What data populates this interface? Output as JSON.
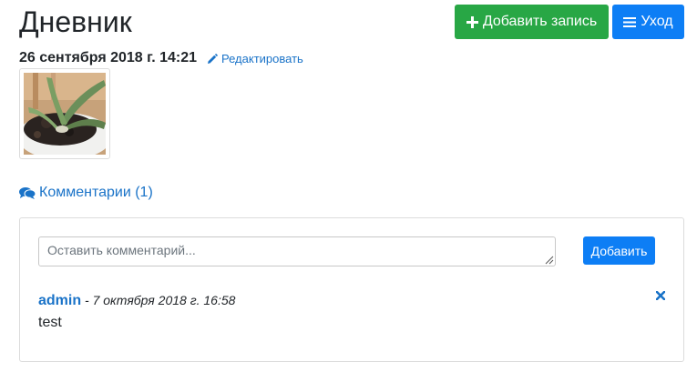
{
  "header": {
    "title": "Дневник",
    "add_button_label": "Добавить запись",
    "care_button_label": "Уход"
  },
  "entry": {
    "date": "26 сентября 2018 г. 14:21",
    "edit_label": "Редактировать",
    "photo_icon": "plant-photo-thumbnail"
  },
  "comments": {
    "toggle_label": "Комментарии (1)",
    "input_placeholder": "Оставить комментарий...",
    "input_value": "",
    "submit_label": "Добавить",
    "items": [
      {
        "author": "admin",
        "separator": " - ",
        "date": "7 октября 2018 г. 16:58",
        "text": "test",
        "delete_icon": "close-icon"
      }
    ]
  },
  "colors": {
    "success": "#28a745",
    "primary": "#0d7ef5",
    "link": "#1a73c8",
    "delete": "#1a73c8"
  }
}
